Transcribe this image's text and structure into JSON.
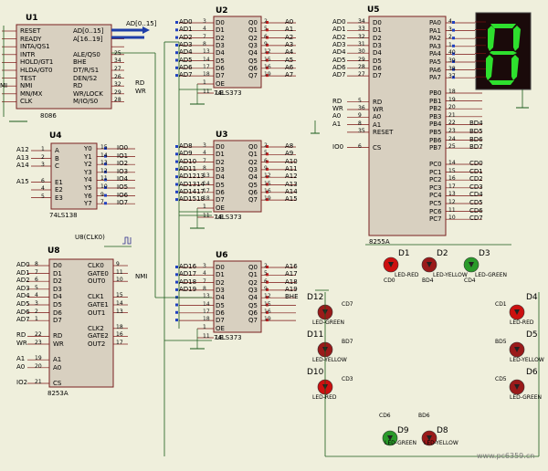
{
  "u1": {
    "ref": "U1",
    "part": "8086",
    "left_pins": [
      "RESET",
      "READY",
      "INTA/QS1",
      "INTR",
      "HOLD/GT1",
      "HLDA/GT0",
      "TEST",
      "NMI",
      "MN/MX",
      "CLK"
    ],
    "right_pins": [
      "AD[0..15]",
      "A[16..19]",
      "",
      "ALE/QS0",
      "BHE",
      "DT/R/S1",
      "DEN/S2",
      "RD",
      "WR/LOCK",
      "M/IO/S0"
    ],
    "right_nums": [
      "",
      "",
      "",
      "25",
      "34",
      "27",
      "26",
      "32",
      "29",
      "28"
    ],
    "bus_label_a": "AD[0..15]",
    "bus_label_b": "A[16..19]",
    "net_rd": "RD",
    "net_wr": "WR",
    "net_mi": "MI"
  },
  "u2": {
    "ref": "U2",
    "part": "74LS373",
    "in_nets": [
      "AD0",
      "AD1",
      "AD2",
      "AD3",
      "AD4",
      "AD5",
      "AD6",
      "AD7"
    ],
    "in_nums": [
      "3",
      "4",
      "7",
      "8",
      "13",
      "14",
      "17",
      "18"
    ],
    "d_pins": [
      "D0",
      "D1",
      "D2",
      "D3",
      "D4",
      "D5",
      "D6",
      "D7"
    ],
    "q_pins": [
      "Q0",
      "Q1",
      "Q2",
      "Q3",
      "Q4",
      "Q5",
      "Q6",
      "Q7"
    ],
    "q_nums": [
      "2",
      "5",
      "6",
      "9",
      "12",
      "15",
      "16",
      "19"
    ],
    "out_nets": [
      "A0",
      "A1",
      "A2",
      "A3",
      "A4",
      "A5",
      "A6",
      "A7"
    ],
    "oe": "OE",
    "le": "LE",
    "oe_num": "1",
    "le_num": "11"
  },
  "u3": {
    "ref": "U3",
    "part": "74LS373",
    "in_nets": [
      "AD8",
      "AD9",
      "AD10",
      "AD11",
      "AD1213",
      "AD1314",
      "AD1417",
      "AD1518"
    ],
    "in_nums": [
      "3",
      "4",
      "7",
      "8",
      "13",
      "14",
      "17",
      "18"
    ],
    "d_pins": [
      "D0",
      "D1",
      "D2",
      "D3",
      "D4",
      "D5",
      "D6",
      "D7"
    ],
    "q_pins": [
      "Q0",
      "Q1",
      "Q2",
      "Q3",
      "Q4",
      "Q5",
      "Q6",
      "Q7"
    ],
    "q_nums": [
      "2",
      "5",
      "6",
      "9",
      "12",
      "15",
      "16",
      "19"
    ],
    "out_nets": [
      "A8",
      "A9",
      "A10",
      "A11",
      "A12",
      "A13",
      "A14",
      "A15"
    ],
    "oe": "OE",
    "le": "LE",
    "oe_num": "1",
    "le_num": "11"
  },
  "u6": {
    "ref": "U6",
    "part": "74LS373",
    "in_nets": [
      "AD16",
      "AD17",
      "AD18",
      "AD19",
      "",
      "",
      "",
      ""
    ],
    "in_nums": [
      "3",
      "4",
      "7",
      "8",
      "13",
      "14",
      "17",
      "18"
    ],
    "d_pins": [
      "D0",
      "D1",
      "D2",
      "D3",
      "D4",
      "D5",
      "D6",
      "D7"
    ],
    "q_pins": [
      "Q0",
      "Q1",
      "Q2",
      "Q3",
      "Q4",
      "Q5",
      "Q6",
      "Q7"
    ],
    "q_nums": [
      "2",
      "5",
      "6",
      "9",
      "12",
      "15",
      "16",
      "19"
    ],
    "out_nets": [
      "A16",
      "A17",
      "A18",
      "A19",
      "BHE",
      "",
      "",
      ""
    ],
    "oe": "OE",
    "le": "LE",
    "oe_num": "1",
    "le_num": "11"
  },
  "u4": {
    "ref": "U4",
    "part": "74LS138",
    "in_nets": [
      "A12",
      "A13",
      "A14",
      "",
      "A15",
      "",
      ""
    ],
    "in_nums": [
      "1",
      "2",
      "3",
      "",
      "6",
      "4",
      "5"
    ],
    "in_pins": [
      "A",
      "B",
      "C",
      "",
      "E1",
      "E2",
      "E3"
    ],
    "y_pins": [
      "Y0",
      "Y1",
      "Y2",
      "Y3",
      "Y4",
      "Y5",
      "Y6",
      "Y7"
    ],
    "y_nums": [
      "15",
      "14",
      "13",
      "12",
      "11",
      "10",
      "9",
      "7"
    ],
    "out_nets": [
      "IO0",
      "IO1",
      "IO2",
      "IO3",
      "IO4",
      "IO5",
      "IO6",
      "IO7"
    ]
  },
  "u8": {
    "ref": "U8",
    "part": "8253A",
    "clk_label": "U8(CLK0)",
    "in_nets": [
      "AD0",
      "AD1",
      "AD2",
      "AD3",
      "AD4",
      "AD5",
      "AD6",
      "AD7",
      "",
      "RD",
      "WR",
      "",
      "A1",
      "A0",
      "",
      "IO2"
    ],
    "in_nums": [
      "8",
      "7",
      "6",
      "5",
      "4",
      "3",
      "2",
      "1",
      "",
      "22",
      "23",
      "",
      "19",
      "20",
      "",
      "21"
    ],
    "in_pins": [
      "D0",
      "D1",
      "D2",
      "D3",
      "D4",
      "D5",
      "D6",
      "D7",
      "",
      "RD",
      "WR",
      "",
      "A1",
      "A0",
      "",
      "CS"
    ],
    "right_pins": [
      "CLK0",
      "GATE0",
      "OUT0",
      "",
      "CLK1",
      "GATE1",
      "OUT1",
      "",
      "CLK2",
      "GATE2",
      "OUT2"
    ],
    "right_nums": [
      "9",
      "11",
      "10",
      "",
      "15",
      "14",
      "13",
      "",
      "18",
      "16",
      "17"
    ],
    "nmi": "NMI"
  },
  "u5": {
    "ref": "U5",
    "part": "8255A",
    "in_nets": [
      "AD0",
      "AD1",
      "AD2",
      "AD3",
      "AD4",
      "AD5",
      "AD6",
      "AD7",
      "",
      "RD",
      "WR",
      "A0",
      "A1",
      "",
      "",
      "IO0"
    ],
    "in_nums": [
      "34",
      "33",
      "32",
      "31",
      "30",
      "29",
      "28",
      "27",
      "",
      "5",
      "36",
      "9",
      "8",
      "35",
      "",
      "6"
    ],
    "in_pins": [
      "D0",
      "D1",
      "D2",
      "D3",
      "D4",
      "D5",
      "D6",
      "D7",
      "",
      "RD",
      "WR",
      "A0",
      "A1",
      "RESET",
      "",
      "CS"
    ],
    "pa_pins": [
      "PA0",
      "PA1",
      "PA2",
      "PA3",
      "PA4",
      "PA5",
      "PA6",
      "PA7"
    ],
    "pa_nums": [
      "4",
      "3",
      "2",
      "1",
      "40",
      "39",
      "38",
      "37"
    ],
    "pb_pins": [
      "PB0",
      "PB1",
      "PB2",
      "PB3",
      "PB4",
      "PB5",
      "PB6",
      "PB7"
    ],
    "pb_nums": [
      "18",
      "19",
      "20",
      "21",
      "22",
      "23",
      "24",
      "25"
    ],
    "pb_nets": [
      "",
      "",
      "",
      "",
      "BD4",
      "BD5",
      "BD6",
      "BD7"
    ],
    "pc_pins": [
      "PC0",
      "PC1",
      "PC2",
      "PC3",
      "PC4",
      "PC5",
      "PC6",
      "PC7"
    ],
    "pc_nums": [
      "14",
      "15",
      "16",
      "17",
      "13",
      "12",
      "11",
      "10"
    ],
    "pc_nets": [
      "CD0",
      "CD1",
      "CD2",
      "CD3",
      "CD4",
      "CD5",
      "CD6",
      "CD7"
    ]
  },
  "seven_seg": {
    "digit": "8"
  },
  "leds": [
    {
      "ref": "D1",
      "type": "LED-RED",
      "net": "CD0",
      "color": "#cc1010"
    },
    {
      "ref": "D2",
      "type": "LED-YELLOW",
      "net": "BD4",
      "color": "#9a1a1a"
    },
    {
      "ref": "D3",
      "type": "LED-GREEN",
      "net": "CD4",
      "color": "#2a9a2a"
    },
    {
      "ref": "D4",
      "type": "LED-RED",
      "net": "CD1",
      "color": "#cc1010"
    },
    {
      "ref": "D5",
      "type": "LED-YELLOW",
      "net": "BD5",
      "color": "#9a1a1a"
    },
    {
      "ref": "D6",
      "type": "LED-GREEN",
      "net": "CD5",
      "color": "#9a1a1a"
    },
    {
      "ref": "D8",
      "type": "LED-YELLOW",
      "net": "BD6",
      "color": "#9a1a1a"
    },
    {
      "ref": "D9",
      "type": "LED-GREEN",
      "net": "CD6",
      "color": "#2a9a2a"
    },
    {
      "ref": "D10",
      "type": "LED-RED",
      "net": "CD3",
      "color": "#cc1010"
    },
    {
      "ref": "D11",
      "type": "LED-YELLOW",
      "net": "BD7",
      "color": "#9a1a1a"
    },
    {
      "ref": "D12",
      "type": "LED-GREEN",
      "net": "CD7",
      "color": "#9a1a1a"
    }
  ],
  "watermark": "www.pc6359.cn"
}
